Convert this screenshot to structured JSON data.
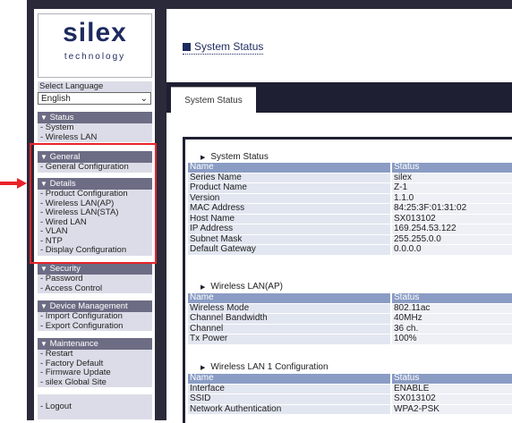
{
  "logo": {
    "main": "silex",
    "sub": "technology"
  },
  "language": {
    "label": "Select Language",
    "selected": "English"
  },
  "sidebar": {
    "status": {
      "title": "Status",
      "items": [
        "- System",
        "- Wireless LAN"
      ]
    },
    "general": {
      "title": "General",
      "items": [
        "- General Configuration"
      ]
    },
    "details": {
      "title": "Details",
      "items": [
        "- Product Configuration",
        "- Wireless LAN(AP)",
        "- Wireless LAN(STA)",
        "- Wired LAN",
        "- VLAN",
        "- NTP",
        "- Display Configuration"
      ]
    },
    "security": {
      "title": "Security",
      "items": [
        "- Password",
        "- Access Control"
      ]
    },
    "device": {
      "title": "Device Management",
      "items": [
        "- Import Configuration",
        "- Export Configuration"
      ]
    },
    "maintenance": {
      "title": "Maintenance",
      "items": [
        "- Restart",
        "- Factory Default",
        "- Firmware Update",
        "- silex Global Site"
      ]
    },
    "logout": "- Logout"
  },
  "page_title": "System Status",
  "tab_label": "System Status",
  "sections": {
    "system": {
      "title": "System Status",
      "header": [
        "Name",
        "Status"
      ],
      "rows": [
        [
          "Series Name",
          "silex"
        ],
        [
          "Product Name",
          "Z-1"
        ],
        [
          "Version",
          "1.1.0"
        ],
        [
          "MAC Address",
          "84:25:3F:01:31:02"
        ],
        [
          "Host Name",
          "SX013102"
        ],
        [
          "IP Address",
          "169.254.53.122"
        ],
        [
          "Subnet Mask",
          "255.255.0.0"
        ],
        [
          "Default Gateway",
          "0.0.0.0"
        ]
      ]
    },
    "wlan_ap": {
      "title": "Wireless LAN(AP)",
      "header": [
        "Name",
        "Status"
      ],
      "rows": [
        [
          "Wireless Mode",
          "802.11ac"
        ],
        [
          "Channel Bandwidth",
          "40MHz"
        ],
        [
          "Channel",
          "36 ch."
        ],
        [
          "Tx Power",
          "100%"
        ]
      ]
    },
    "wlan1": {
      "title": "Wireless LAN 1 Configuration",
      "header": [
        "Name",
        "Status"
      ],
      "rows": [
        [
          "Interface",
          "ENABLE"
        ],
        [
          "SSID",
          "SX013102"
        ],
        [
          "Network Authentication",
          "WPA2-PSK"
        ]
      ]
    }
  },
  "colors": {
    "frame": "#2a2a3a",
    "highlight": "#e8232a",
    "header_row": "#8a9cc4",
    "section_bar": "#6c6c84"
  }
}
